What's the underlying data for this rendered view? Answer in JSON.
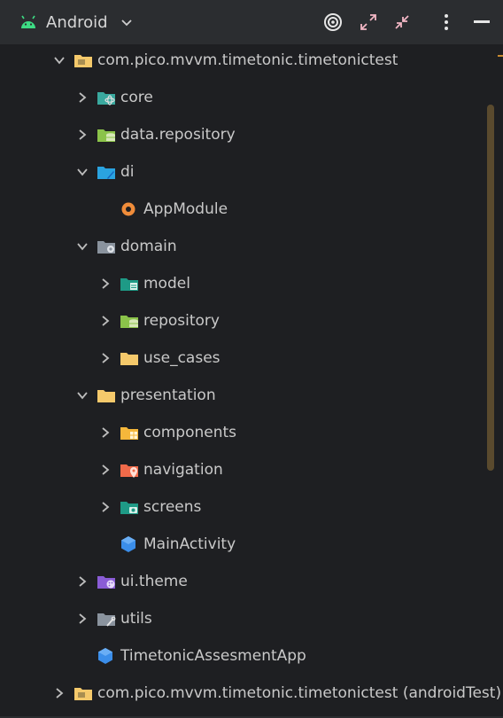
{
  "toolbar": {
    "view_label": "Android",
    "icons": [
      "android-icon",
      "chevron-down-icon",
      "target-icon",
      "expand-icon",
      "collapse-icon",
      "more-vert-icon",
      "minimize-icon"
    ]
  },
  "tree": {
    "items": [
      {
        "label": "com.pico.mvvm.timetonic.timetonictest",
        "expanded": true,
        "icon": "package-folder-icon"
      },
      {
        "label": "core",
        "expanded": false,
        "icon": "core-folder-icon"
      },
      {
        "label": "data.repository",
        "expanded": false,
        "icon": "database-folder-icon"
      },
      {
        "label": "di",
        "expanded": true,
        "icon": "di-folder-icon"
      },
      {
        "label": "AppModule",
        "icon": "kotlin-object-icon"
      },
      {
        "label": "domain",
        "expanded": true,
        "icon": "domain-folder-icon"
      },
      {
        "label": "model",
        "expanded": false,
        "icon": "model-folder-icon"
      },
      {
        "label": "repository",
        "expanded": false,
        "icon": "database-folder-icon"
      },
      {
        "label": "use_cases",
        "expanded": false,
        "icon": "folder-icon"
      },
      {
        "label": "presentation",
        "expanded": true,
        "icon": "folder-icon"
      },
      {
        "label": "components",
        "expanded": false,
        "icon": "components-folder-icon"
      },
      {
        "label": "navigation",
        "expanded": false,
        "icon": "navigation-folder-icon"
      },
      {
        "label": "screens",
        "expanded": false,
        "icon": "screens-folder-icon"
      },
      {
        "label": "MainActivity",
        "icon": "activity-class-icon"
      },
      {
        "label": "ui.theme",
        "expanded": false,
        "icon": "theme-folder-icon"
      },
      {
        "label": "utils",
        "expanded": false,
        "icon": "utils-folder-icon"
      },
      {
        "label": "TimetonicAssesmentApp",
        "icon": "application-class-icon"
      },
      {
        "label": "com.pico.mvvm.timetonic.timetonictest (androidTest)",
        "expanded": false,
        "icon": "package-folder-icon"
      }
    ]
  },
  "colors": {
    "background": "#1e1f22",
    "toolbar": "#2b2d30",
    "folder_yellow": "#f5c96b",
    "accent_teal": "#3aa99f",
    "accent_green": "#8bc34a",
    "accent_blue": "#3b8eea",
    "accent_orange": "#f08c3a",
    "accent_purple": "#8a5cd6"
  }
}
